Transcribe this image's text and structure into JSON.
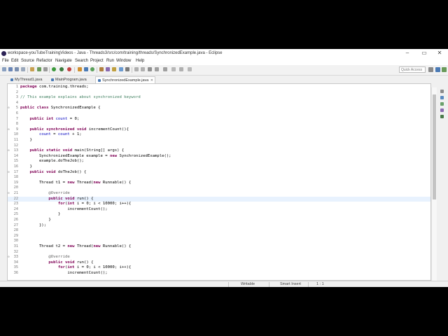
{
  "window": {
    "title": "workspace-youTubeTrainingVideos - Java - Threads3/src/com/training/threads/SynchronizedExample.java - Eclipse",
    "minimize": "–",
    "maximize": "▭",
    "close": "✕"
  },
  "menu": [
    "File",
    "Edit",
    "Source",
    "Refactor",
    "Navigate",
    "Search",
    "Project",
    "Run",
    "Window",
    "Help"
  ],
  "toolbar": {
    "quick_access": "Quick Access"
  },
  "tabs": [
    {
      "label": "MyThread1.java",
      "active": false
    },
    {
      "label": "MainProgram.java",
      "active": false
    },
    {
      "label": "SynchronizedExample.java",
      "active": true
    }
  ],
  "editor": {
    "current_line": 22,
    "lines": [
      {
        "n": "1",
        "t": "package com.training.threads;"
      },
      {
        "n": "2",
        "t": ""
      },
      {
        "n": "3",
        "t": "// This example explains about synchronized keyword"
      },
      {
        "n": "4",
        "t": ""
      },
      {
        "n": "5",
        "t": "public class SynchronizedExample {"
      },
      {
        "n": "6",
        "t": ""
      },
      {
        "n": "7",
        "t": "    public int count = 0;"
      },
      {
        "n": "8",
        "t": ""
      },
      {
        "n": "9",
        "t": "    public synchronized void incrementCount(){"
      },
      {
        "n": "10",
        "t": "        count = count + 1;"
      },
      {
        "n": "11",
        "t": "    }"
      },
      {
        "n": "12",
        "t": ""
      },
      {
        "n": "13",
        "t": "    public static void main(String[] args) {"
      },
      {
        "n": "14",
        "t": "        SynchronizedExample example = new SynchronizedExample();"
      },
      {
        "n": "15",
        "t": "        example.doTheJob();"
      },
      {
        "n": "16",
        "t": "    }"
      },
      {
        "n": "17",
        "t": "    public void doTheJob() {"
      },
      {
        "n": "18",
        "t": ""
      },
      {
        "n": "19",
        "t": "        Thread t1 = new Thread(new Runnable() {"
      },
      {
        "n": "20",
        "t": ""
      },
      {
        "n": "21",
        "t": "            @Override"
      },
      {
        "n": "22",
        "t": "            public void run() {"
      },
      {
        "n": "23",
        "t": "                for(int i = 0; i < 10000; i++){"
      },
      {
        "n": "24",
        "t": "                    incrementCount();"
      },
      {
        "n": "25",
        "t": "                }"
      },
      {
        "n": "26",
        "t": "            }"
      },
      {
        "n": "27",
        "t": "        });"
      },
      {
        "n": "28",
        "t": ""
      },
      {
        "n": "29",
        "t": ""
      },
      {
        "n": "30",
        "t": ""
      },
      {
        "n": "31",
        "t": "        Thread t2 = new Thread(new Runnable() {"
      },
      {
        "n": "32",
        "t": ""
      },
      {
        "n": "33",
        "t": "            @Override"
      },
      {
        "n": "34",
        "t": "            public void run() {"
      },
      {
        "n": "35",
        "t": "                for(int i = 0; i < 10000; i++){"
      },
      {
        "n": "36",
        "t": "                    incrementCount();"
      }
    ]
  },
  "status": {
    "writable": "Writable",
    "insert_mode": "Smart Insert",
    "position": "1 : 1"
  },
  "colors": {
    "keyword": "#7f0055",
    "comment": "#3f7f5f",
    "annotation": "#646464",
    "field": "#0000c0",
    "current_line": "#e8f2fe"
  }
}
